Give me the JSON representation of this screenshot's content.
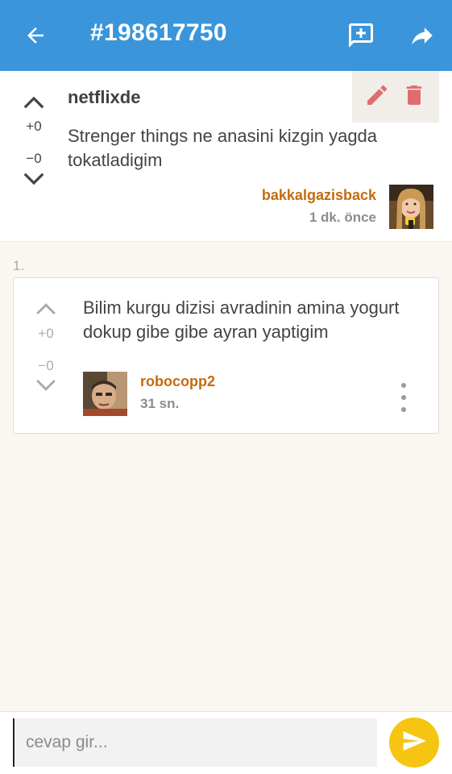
{
  "appbar": {
    "title": "#198617750",
    "back_icon": "arrow-left-icon",
    "add_comment_icon": "comment-add-icon",
    "share_icon": "share-icon",
    "background": "#3a95db"
  },
  "entry": {
    "topic": "netflixde",
    "body": "Strenger things ne anasini kizgin yagda tokatladigim",
    "upvotes": "+0",
    "downvotes": "−0",
    "author": "bakkalgazisback",
    "time": "1 dk. önce",
    "edit_icon": "pencil-icon",
    "delete_icon": "trash-icon"
  },
  "comments": {
    "index_label": "1.",
    "items": [
      {
        "body": "Bilim kurgu dizisi avradinin amina yogurt dokup gibe gibe ayran yaptigim",
        "upvotes": "+0",
        "downvotes": "−0",
        "author": "robocopp2",
        "time": "31 sn.",
        "more_icon": "more-vertical-icon"
      }
    ]
  },
  "reply": {
    "placeholder": "cevap gir...",
    "value": "",
    "send_icon": "send-icon",
    "send_color": "#f5c512"
  },
  "colors": {
    "author": "#c46b0f",
    "meta": "#8c8c8c",
    "delete": "#e06d6d"
  }
}
